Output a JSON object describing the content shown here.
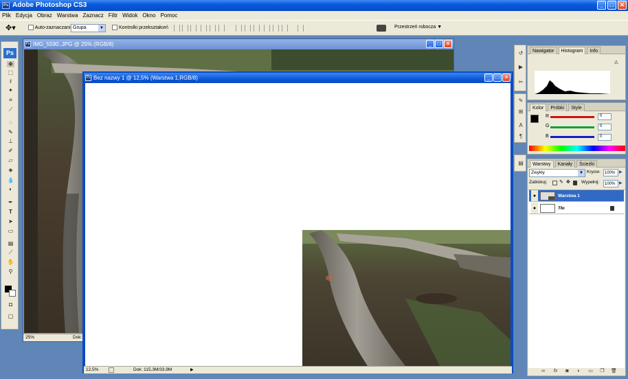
{
  "app": {
    "title": "Adobe Photoshop CS3",
    "win_min": "_",
    "win_max": "□",
    "win_close": "✕"
  },
  "menu": [
    "Plik",
    "Edycja",
    "Obraz",
    "Warstwa",
    "Zaznacz",
    "Filtr",
    "Widok",
    "Okno",
    "Pomoc"
  ],
  "options": {
    "auto_select_label": "Auto-zaznaczanie:",
    "auto_select_value": "Grupa",
    "transform_label": "Kontrolki przekształceń",
    "workspace_label": "Przestrzeń robocza ▼"
  },
  "doc1": {
    "title": "IMG_5590..JPG @ 25% (RGB/8)",
    "zoom": "25%",
    "status": "Dok:"
  },
  "doc2": {
    "title": "Bez nazwy 1 @ 12,5% (Warstwa 1,RGB/8)",
    "zoom": "12,5%",
    "status": "Dok: 115,3M/33,9M"
  },
  "toolbox": {
    "logo": "Ps"
  },
  "panel_nav": {
    "tabs": [
      "Nawigator",
      "Histogram",
      "Info"
    ],
    "active": "Histogram",
    "warning": "⚠"
  },
  "panel_color": {
    "tabs": [
      "Kolor",
      "Próbki",
      "Style"
    ],
    "active": "Kolor",
    "channels": [
      {
        "label": "R",
        "value": "0",
        "color": "#d01010"
      },
      {
        "label": "G",
        "value": "0",
        "color": "#10a030"
      },
      {
        "label": "B",
        "value": "0",
        "color": "#1020c0"
      }
    ]
  },
  "panel_layers": {
    "tabs": [
      "Warstwy",
      "Kanały",
      "Ścieżki"
    ],
    "active": "Warstwy",
    "blend_mode": "Zwykły",
    "opacity_label": "Krycie:",
    "opacity_value": "100%",
    "lock_label": "Zablokuj:",
    "fill_label": "Wypełnij:",
    "fill_value": "100%",
    "layers": [
      {
        "name": "Warstwa 1",
        "selected": true
      },
      {
        "name": "Tło",
        "selected": false
      }
    ],
    "bottom_icons": [
      "link-icon",
      "fx-icon",
      "mask-icon",
      "adjustment-icon",
      "group-icon",
      "new-layer-icon",
      "trash-icon"
    ]
  },
  "icons": {
    "arrow": "▶",
    "dropdown": "▼",
    "lock": "🔒",
    "eye": "👁"
  },
  "colors": {
    "accent": "#0a58d8",
    "selected_layer": "#316ac5",
    "app_bg": "#5f86b6"
  }
}
